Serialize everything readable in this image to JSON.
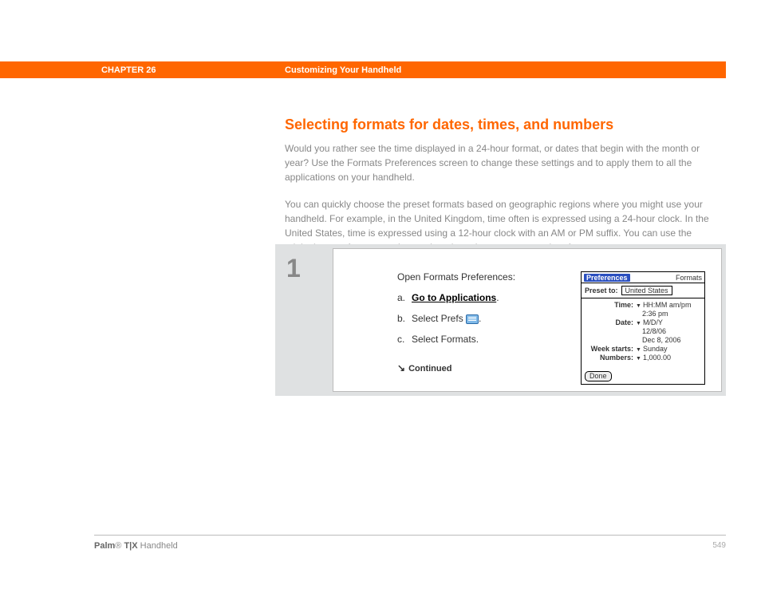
{
  "header": {
    "chapter": "CHAPTER 26",
    "title": "Customizing Your Handheld"
  },
  "section": {
    "heading": "Selecting formats for dates, times, and numbers",
    "para1": "Would you rather see the time displayed in a 24-hour format, or dates that begin with the month or year? Use the Formats Preferences screen to change these settings and to apply them to all the applications on your handheld.",
    "para2": "You can quickly choose the preset formats based on geographic regions where you might use your handheld. For example, in the United Kingdom, time often is expressed using a 24-hour clock. In the United States, time is expressed using a 12-hour clock with an AM or PM suffix. You can use the original preset formats or change them based on your personal preferences."
  },
  "step": {
    "number": "1",
    "lead": "Open Formats Preferences:",
    "a_letter": "a.",
    "a_text": "Go to Applications",
    "a_dot": ".",
    "b_letter": "b.",
    "b_pre": "Select Prefs ",
    "b_post": ".",
    "c_letter": "c.",
    "c_text": "Select Formats.",
    "continued": "Continued"
  },
  "palm": {
    "pref": "Preferences",
    "formats": "Formats",
    "preset_label": "Preset to:",
    "preset_value": "United States",
    "time_label": "Time:",
    "time_val": "HH:MM am/pm",
    "time_sub": "2:36 pm",
    "date_label": "Date:",
    "date_val": "M/D/Y",
    "date_sub1": "12/8/06",
    "date_sub2": "Dec 8, 2006",
    "week_label": "Week starts:",
    "week_val": "Sunday",
    "num_label": "Numbers:",
    "num_val": "1,000.00",
    "done": "Done"
  },
  "footer": {
    "brand_bold": "Palm",
    "brand_reg": "®",
    "brand_model": " T|X",
    "brand_tail": " Handheld",
    "page": "549"
  }
}
